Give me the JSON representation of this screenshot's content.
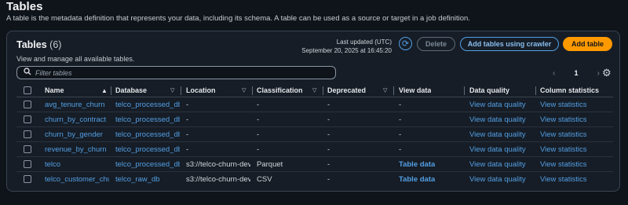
{
  "page": {
    "title": "Tables",
    "description": "A table is the metadata definition that represents your data, including its schema. A table can be used as a source or target in a job definition."
  },
  "panel": {
    "title": "Tables",
    "count": "(6)",
    "description": "View and manage all available tables.",
    "last_updated_label": "Last updated (UTC)",
    "last_updated_value": "September 20, 2025 at 16:45:20",
    "buttons": {
      "delete": "Delete",
      "crawler": "Add tables using crawler",
      "add": "Add table"
    },
    "filter_placeholder": "Filter tables",
    "page_number": "1"
  },
  "columns": {
    "name": "Name",
    "database": "Database",
    "location": "Location",
    "classification": "Classification",
    "deprecated": "Deprecated",
    "view_data": "View data",
    "data_quality": "Data quality",
    "column_statistics": "Column statistics"
  },
  "rows": [
    {
      "name": "avg_tenure_churn",
      "database": "telco_processed_db",
      "location": "-",
      "classification": "-",
      "deprecated": "-",
      "view_data": "-",
      "data_quality": "View data quality",
      "column_statistics": "View statistics"
    },
    {
      "name": "churn_by_contract",
      "database": "telco_processed_db",
      "location": "-",
      "classification": "-",
      "deprecated": "-",
      "view_data": "-",
      "data_quality": "View data quality",
      "column_statistics": "View statistics"
    },
    {
      "name": "churn_by_gender",
      "database": "telco_processed_db",
      "location": "-",
      "classification": "-",
      "deprecated": "-",
      "view_data": "-",
      "data_quality": "View data quality",
      "column_statistics": "View statistics"
    },
    {
      "name": "revenue_by_churn",
      "database": "telco_processed_db",
      "location": "-",
      "classification": "-",
      "deprecated": "-",
      "view_data": "-",
      "data_quality": "View data quality",
      "column_statistics": "View statistics"
    },
    {
      "name": "telco",
      "database": "telco_processed_db",
      "location": "s3://telco-churn-dev",
      "classification": "Parquet",
      "deprecated": "-",
      "view_data": "Table data",
      "data_quality": "View data quality",
      "column_statistics": "View statistics"
    },
    {
      "name": "telco_customer_chu",
      "database": "telco_raw_db",
      "location": "s3://telco-churn-dev",
      "classification": "CSV",
      "deprecated": "-",
      "view_data": "Table data",
      "data_quality": "View data quality",
      "column_statistics": "View statistics"
    }
  ],
  "icons": {
    "refresh": "refresh-icon",
    "search": "search-icon",
    "settings": "gear-icon",
    "prev": "chevron-left-icon",
    "next": "chevron-right-icon"
  },
  "colors": {
    "accent": "#539fe5",
    "primary_button": "#ff9900",
    "background": "#0f141a",
    "panel": "#161d26"
  }
}
